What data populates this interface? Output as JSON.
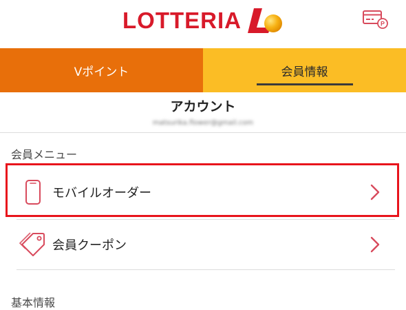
{
  "header": {
    "brand_name": "LOTTERIA",
    "brand_color": "#d81a2a",
    "card_icon": "membership-card-icon"
  },
  "tabs": [
    {
      "label": "Vポイント",
      "active": false,
      "color": "#e86f0a"
    },
    {
      "label": "会員情報",
      "active": true,
      "color": "#fbbd25"
    }
  ],
  "account": {
    "title": "アカウント",
    "email": "matsurika.flower@gmail.com"
  },
  "member_menu": {
    "section_label": "会員メニュー",
    "items": [
      {
        "label": "モバイルオーダー",
        "icon": "smartphone-icon",
        "highlighted": true
      },
      {
        "label": "会員クーポン",
        "icon": "coupon-tag-icon",
        "highlighted": false
      }
    ]
  },
  "basic_info": {
    "section_label": "基本情報"
  },
  "colors": {
    "accent_red": "#d84a5c",
    "highlight": "#e8141c"
  }
}
